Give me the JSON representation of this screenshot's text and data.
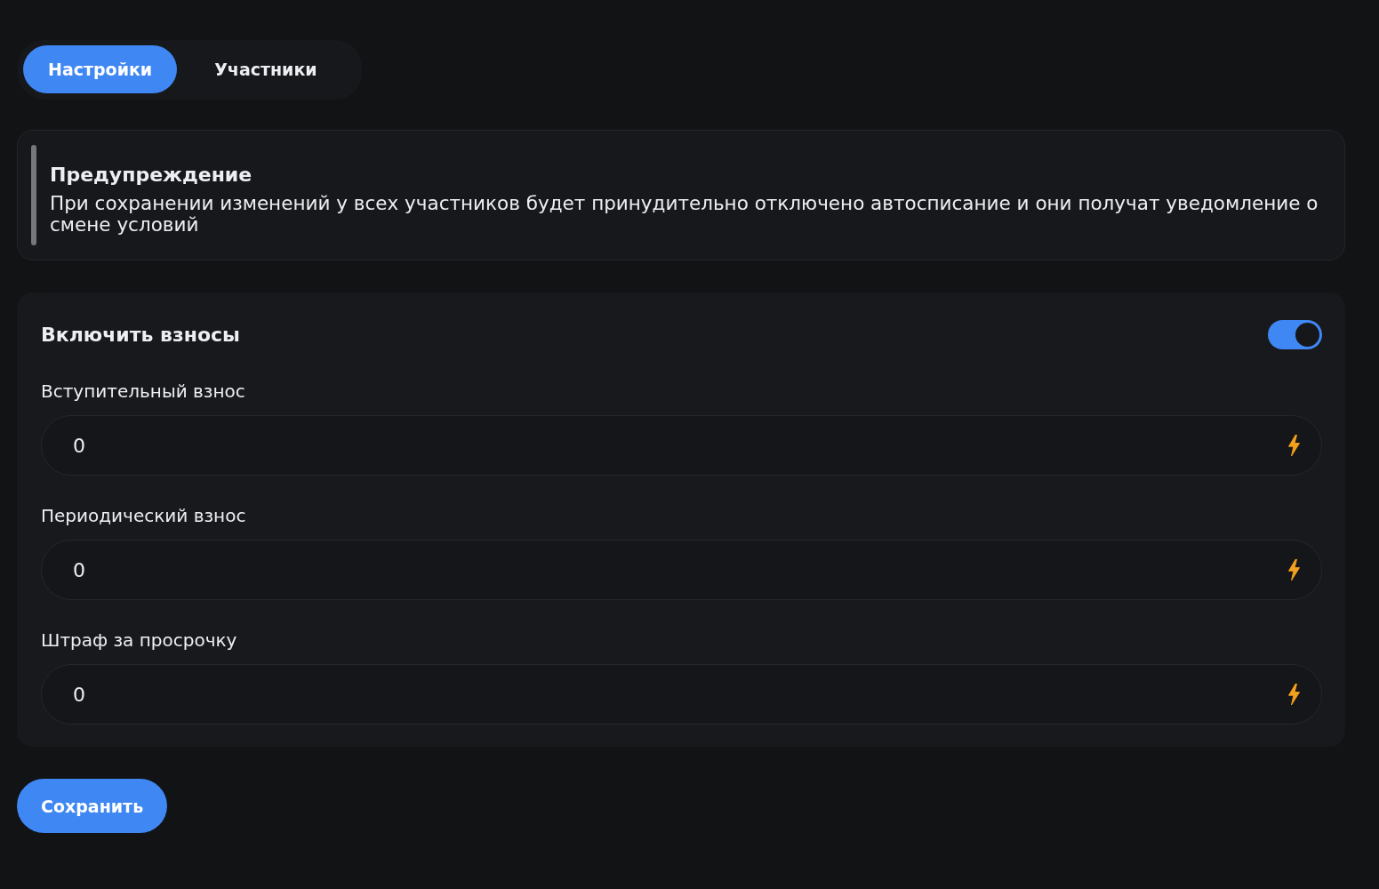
{
  "tabs": [
    {
      "label": "Настройки",
      "selected": true
    },
    {
      "label": "Участники",
      "selected": false
    }
  ],
  "warning": {
    "title": "Предупреждение",
    "text": "При сохранении изменений у всех участников будет принудительно отключено автосписание и они получат уведомление о смене условий"
  },
  "dues": {
    "title": "Включить взносы",
    "on": true,
    "fields": [
      {
        "label": "Вступительный взнос",
        "value": "0"
      },
      {
        "label": "Периодический взнос",
        "value": "0"
      },
      {
        "label": "Штраф за просрочку",
        "value": "0"
      }
    ]
  },
  "buttons": [
    "Сохранить"
  ]
}
